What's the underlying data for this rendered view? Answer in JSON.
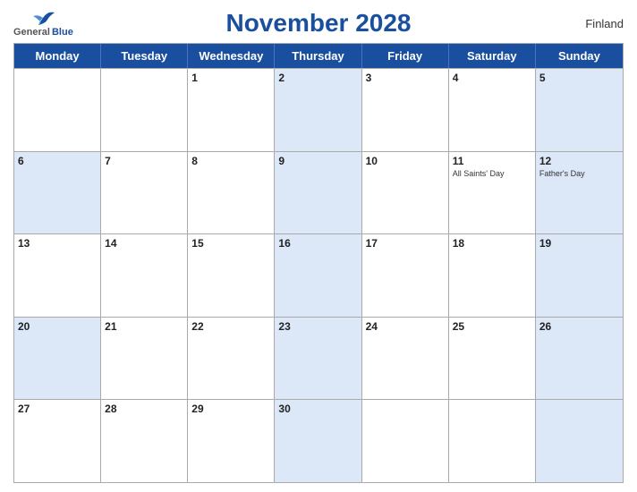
{
  "header": {
    "title": "November 2028",
    "country": "Finland",
    "logo": {
      "general": "General",
      "blue": "Blue"
    }
  },
  "weekdays": [
    "Monday",
    "Tuesday",
    "Wednesday",
    "Thursday",
    "Friday",
    "Saturday",
    "Sunday"
  ],
  "weeks": [
    [
      {
        "day": "",
        "blue": false,
        "holiday": ""
      },
      {
        "day": "",
        "blue": false,
        "holiday": ""
      },
      {
        "day": "1",
        "blue": false,
        "holiday": ""
      },
      {
        "day": "2",
        "blue": true,
        "holiday": ""
      },
      {
        "day": "3",
        "blue": false,
        "holiday": ""
      },
      {
        "day": "4",
        "blue": false,
        "holiday": ""
      },
      {
        "day": "5",
        "blue": true,
        "holiday": ""
      }
    ],
    [
      {
        "day": "6",
        "blue": true,
        "holiday": ""
      },
      {
        "day": "7",
        "blue": false,
        "holiday": ""
      },
      {
        "day": "8",
        "blue": false,
        "holiday": ""
      },
      {
        "day": "9",
        "blue": true,
        "holiday": ""
      },
      {
        "day": "10",
        "blue": false,
        "holiday": ""
      },
      {
        "day": "11",
        "blue": false,
        "holiday": "All Saints' Day"
      },
      {
        "day": "12",
        "blue": true,
        "holiday": "Father's Day"
      }
    ],
    [
      {
        "day": "13",
        "blue": false,
        "holiday": ""
      },
      {
        "day": "14",
        "blue": false,
        "holiday": ""
      },
      {
        "day": "15",
        "blue": false,
        "holiday": ""
      },
      {
        "day": "16",
        "blue": true,
        "holiday": ""
      },
      {
        "day": "17",
        "blue": false,
        "holiday": ""
      },
      {
        "day": "18",
        "blue": false,
        "holiday": ""
      },
      {
        "day": "19",
        "blue": true,
        "holiday": ""
      }
    ],
    [
      {
        "day": "20",
        "blue": true,
        "holiday": ""
      },
      {
        "day": "21",
        "blue": false,
        "holiday": ""
      },
      {
        "day": "22",
        "blue": false,
        "holiday": ""
      },
      {
        "day": "23",
        "blue": true,
        "holiday": ""
      },
      {
        "day": "24",
        "blue": false,
        "holiday": ""
      },
      {
        "day": "25",
        "blue": false,
        "holiday": ""
      },
      {
        "day": "26",
        "blue": true,
        "holiday": ""
      }
    ],
    [
      {
        "day": "27",
        "blue": false,
        "holiday": ""
      },
      {
        "day": "28",
        "blue": false,
        "holiday": ""
      },
      {
        "day": "29",
        "blue": false,
        "holiday": ""
      },
      {
        "day": "30",
        "blue": true,
        "holiday": ""
      },
      {
        "day": "",
        "blue": false,
        "holiday": ""
      },
      {
        "day": "",
        "blue": false,
        "holiday": ""
      },
      {
        "day": "",
        "blue": true,
        "holiday": ""
      }
    ]
  ]
}
